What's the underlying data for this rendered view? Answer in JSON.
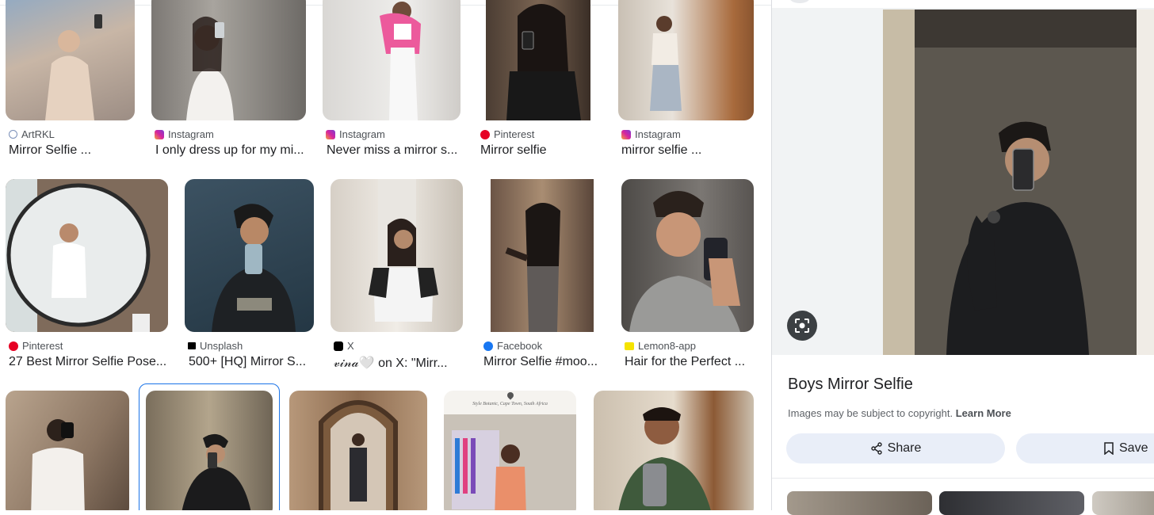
{
  "results": [
    {
      "source": "ArtRKL",
      "favicon": "artrkl-icon",
      "title": "Mirror Selfie ..."
    },
    {
      "source": "Instagram",
      "favicon": "instagram-icon",
      "title": "I only dress up for my mi..."
    },
    {
      "source": "Instagram",
      "favicon": "instagram-icon",
      "title": "Never miss a mirror s..."
    },
    {
      "source": "Pinterest",
      "favicon": "pinterest-icon",
      "title": "Mirror selfie"
    },
    {
      "source": "Instagram",
      "favicon": "instagram-icon",
      "title": "mirror selfie ..."
    },
    {
      "source": "Pinterest",
      "favicon": "pinterest-icon",
      "title": "27 Best Mirror Selfie Pose..."
    },
    {
      "source": "Unsplash",
      "favicon": "unsplash-icon",
      "title": "500+ [HQ] Mirror S..."
    },
    {
      "source": "X",
      "favicon": "x-icon",
      "title": "𝓋𝒾𝓃𝒶🤍  on X: \"Mirr..."
    },
    {
      "source": "Facebook",
      "favicon": "facebook-icon",
      "title": "Mirror Selfie #moo..."
    },
    {
      "source": "Lemon8-app",
      "favicon": "lemon8-icon",
      "title": "Hair for the Perfect ..."
    }
  ],
  "bottom_row": [
    {
      "label": "",
      "selected": false
    },
    {
      "label": "",
      "selected": true
    },
    {
      "label": "",
      "selected": false
    },
    {
      "caption": "Style Botanic, Cape Town, South Africa",
      "selected": false
    },
    {
      "label": "",
      "selected": false
    }
  ],
  "panel": {
    "title": "Boys Mirror Selfie",
    "copyright": "Images may be subject to copyright.",
    "learn_more": "Learn More",
    "share": "Share",
    "save": "Save",
    "lens_icon": "lens-icon"
  },
  "colors": {
    "selected_border": "#1a73e8",
    "pill_bg": "#e9eef8",
    "instagram": "#d6249f",
    "pinterest": "#e60023",
    "facebook": "#1877f2",
    "lemon8": "#f5e300"
  }
}
